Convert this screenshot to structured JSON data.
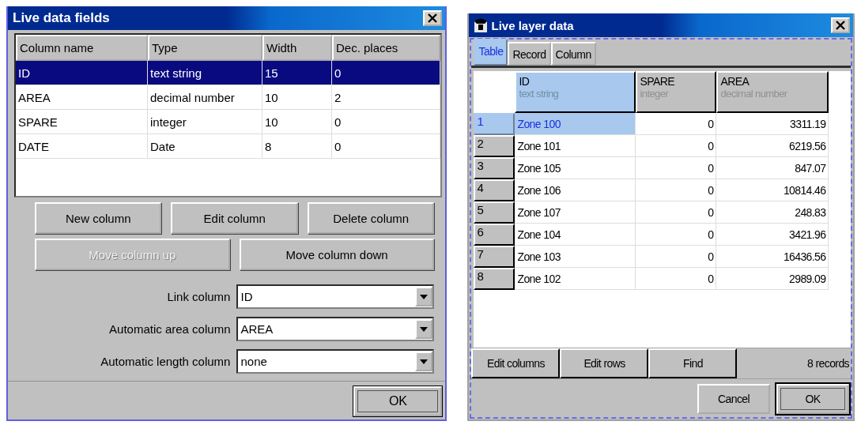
{
  "fields_window": {
    "title": "Live data fields",
    "table": {
      "columns": [
        "Column name",
        "Type",
        "Width",
        "Dec. places"
      ],
      "rows": [
        {
          "cells": [
            "ID",
            "text string",
            "15",
            "0"
          ],
          "selected": true
        },
        {
          "cells": [
            "AREA",
            "decimal number",
            "10",
            "2"
          ],
          "selected": false
        },
        {
          "cells": [
            "SPARE",
            "integer",
            "10",
            "0"
          ],
          "selected": false
        },
        {
          "cells": [
            "DATE",
            "Date",
            "8",
            "0"
          ],
          "selected": false
        }
      ]
    },
    "button_rows": [
      [
        {
          "label": "New column",
          "disabled": false
        },
        {
          "label": "Edit column",
          "disabled": false
        },
        {
          "label": "Delete column",
          "disabled": false
        }
      ],
      [
        {
          "label": "Move column up",
          "disabled": true
        },
        {
          "label": "Move column down",
          "disabled": false
        }
      ]
    ],
    "fields": [
      {
        "label": "Link column",
        "value": "ID"
      },
      {
        "label": "Automatic area column",
        "value": "AREA"
      },
      {
        "label": "Automatic length column",
        "value": "none"
      }
    ],
    "footer_buttons": [
      {
        "label": "OK",
        "focused": true
      }
    ]
  },
  "layer_window": {
    "title": "Live layer data",
    "tabs": [
      {
        "label": "Table",
        "selected": true
      },
      {
        "label": "Record",
        "selected": false
      },
      {
        "label": "Column",
        "selected": false
      }
    ],
    "grid": {
      "columns": [
        {
          "name": "ID",
          "type": "text string",
          "selected": true
        },
        {
          "name": "SPARE",
          "type": "integer",
          "selected": false
        },
        {
          "name": "AREA",
          "type": "decimal number",
          "selected": false
        }
      ],
      "rows": [
        {
          "number": "1",
          "cells": [
            "Zone 100",
            "0",
            "3311.19"
          ],
          "selected": true
        },
        {
          "number": "2",
          "cells": [
            "Zone 101",
            "0",
            "6219.56"
          ],
          "selected": false
        },
        {
          "number": "3",
          "cells": [
            "Zone 105",
            "0",
            "847.07"
          ],
          "selected": false
        },
        {
          "number": "4",
          "cells": [
            "Zone 106",
            "0",
            "10814.46"
          ],
          "selected": false
        },
        {
          "number": "5",
          "cells": [
            "Zone 107",
            "0",
            "248.83"
          ],
          "selected": false
        },
        {
          "number": "6",
          "cells": [
            "Zone 104",
            "0",
            "3421.96"
          ],
          "selected": false
        },
        {
          "number": "7",
          "cells": [
            "Zone 103",
            "0",
            "16436.56"
          ],
          "selected": false
        },
        {
          "number": "8",
          "cells": [
            "Zone 102",
            "0",
            "2989.09"
          ],
          "selected": false
        }
      ]
    },
    "buttons": [
      "Edit columns",
      "Edit rows",
      "Find"
    ],
    "record_count": "8 records",
    "footer_buttons": [
      {
        "label": "Cancel",
        "focused": false
      },
      {
        "label": "OK",
        "focused": true
      }
    ]
  }
}
